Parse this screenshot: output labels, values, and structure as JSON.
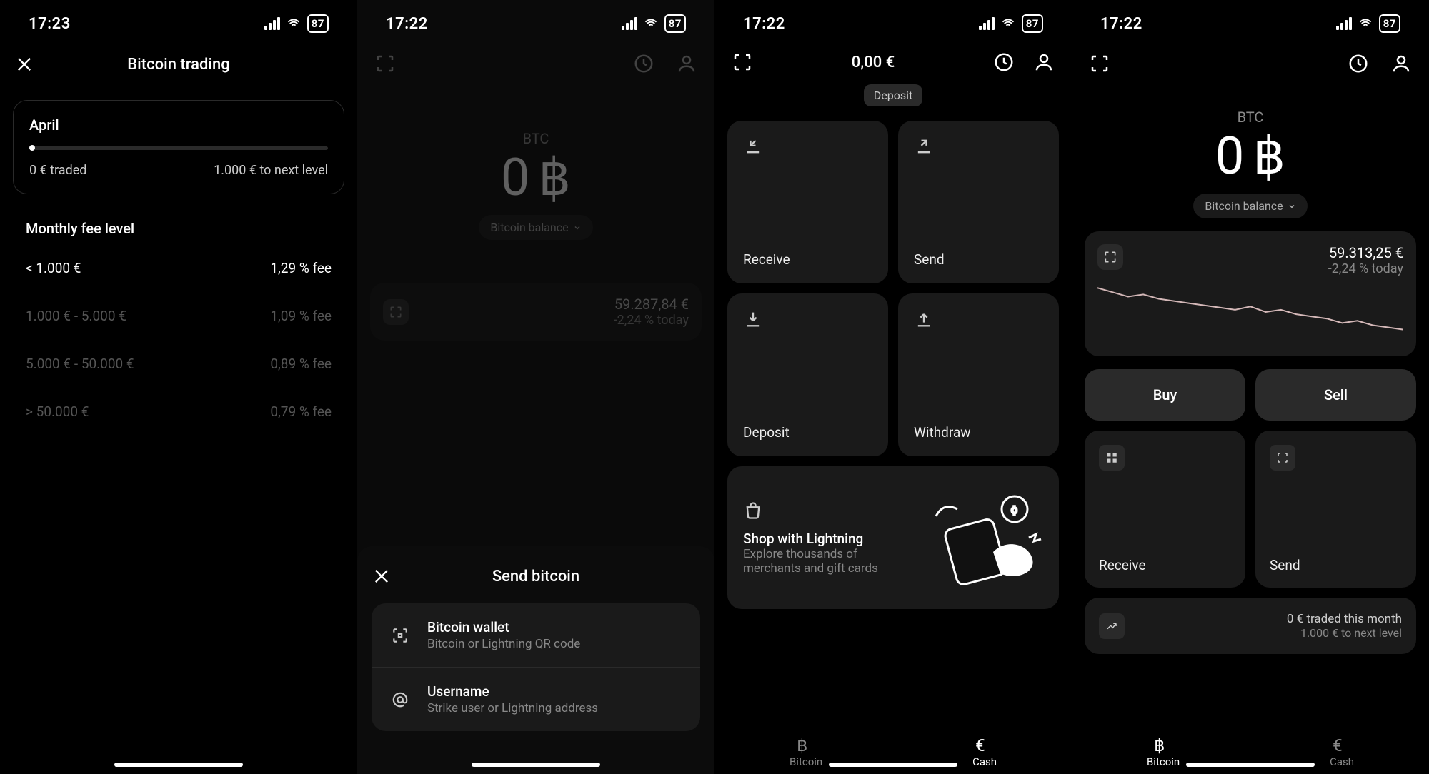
{
  "status": {
    "time1": "17:23",
    "time2": "17:22",
    "time3": "17:22",
    "time4": "17:22",
    "battery": "87"
  },
  "screen1": {
    "title": "Bitcoin trading",
    "month": "April",
    "traded": "0 € traded",
    "to_next": "1.000 € to next level",
    "section": "Monthly fee level",
    "rows": [
      {
        "range": "< 1.000 €",
        "fee": "1,29 % fee"
      },
      {
        "range": "1.000 € - 5.000 €",
        "fee": "1,09 % fee"
      },
      {
        "range": "5.000 € - 50.000 €",
        "fee": "0,89 % fee"
      },
      {
        "range": "> 50.000 €",
        "fee": "0,79 % fee"
      }
    ]
  },
  "screen2": {
    "btc_label": "BTC",
    "balance_amount": "0",
    "balance_pill": "Bitcoin balance",
    "price": "59.287,84 €",
    "change": "-2,24 % today",
    "sheet_title": "Send bitcoin",
    "opt1_title": "Bitcoin wallet",
    "opt1_sub": "Bitcoin or Lightning QR code",
    "opt2_title": "Username",
    "opt2_sub": "Strike user or Lightning address"
  },
  "screen3": {
    "balance": "0,00 €",
    "deposit_hint": "Deposit",
    "tiles": {
      "receive": "Receive",
      "send": "Send",
      "deposit": "Deposit",
      "withdraw": "Withdraw"
    },
    "shop_title": "Shop with Lightning",
    "shop_sub": "Explore thousands of merchants and gift cards",
    "nav": {
      "bitcoin": "Bitcoin",
      "cash": "Cash"
    }
  },
  "screen4": {
    "btc_label": "BTC",
    "balance_amount": "0",
    "balance_pill": "Bitcoin balance",
    "price": "59.313,25 €",
    "change": "-2,24 % today",
    "buy": "Buy",
    "sell": "Sell",
    "receive": "Receive",
    "send": "Send",
    "traded_line": "0 € traded this month",
    "next_level": "1.000 € to next level",
    "nav": {
      "bitcoin": "Bitcoin",
      "cash": "Cash"
    }
  },
  "chart_data": {
    "type": "line",
    "title": "",
    "xlabel": "",
    "ylabel": "",
    "ylim": [
      57800,
      60400
    ],
    "x": [
      0,
      0.05,
      0.1,
      0.15,
      0.2,
      0.25,
      0.3,
      0.35,
      0.4,
      0.45,
      0.5,
      0.55,
      0.6,
      0.65,
      0.7,
      0.75,
      0.8,
      0.85,
      0.9,
      0.95,
      1.0
    ],
    "values": [
      60200,
      60000,
      59800,
      59900,
      59700,
      59600,
      59500,
      59400,
      59300,
      59200,
      59350,
      59100,
      59200,
      59000,
      58900,
      58800,
      58600,
      58700,
      58500,
      58400,
      58300
    ]
  }
}
